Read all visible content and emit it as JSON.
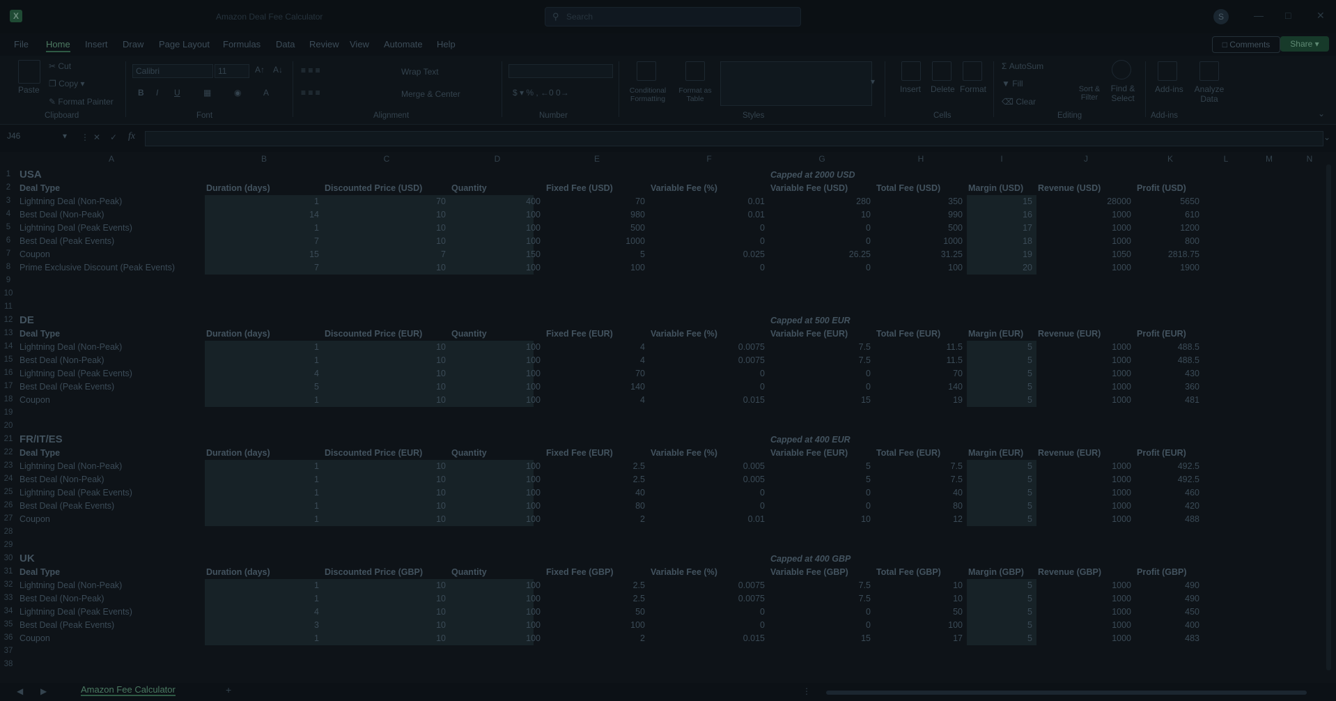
{
  "titlebar": {
    "app_icon": "excel-icon",
    "title": "Amazon Deal Fee Calculator",
    "search_placeholder": "Search",
    "avatar_letter": "S"
  },
  "menu": {
    "items": [
      "File",
      "Home",
      "Insert",
      "Draw",
      "Page Layout",
      "Formulas",
      "Data",
      "Review",
      "View",
      "Automate",
      "Help"
    ],
    "active": "Home",
    "comments_label": "Comments",
    "share_label": "Share"
  },
  "ribbon": {
    "clipboard": {
      "paste": "Paste",
      "cut": "Cut",
      "copy": "Copy",
      "format_painter": "Format Painter",
      "group": "Clipboard"
    },
    "font": {
      "name": "Calibri",
      "size": "11",
      "group": "Font"
    },
    "alignment": {
      "wrap": "Wrap Text",
      "merge": "Merge & Center",
      "group": "Alignment"
    },
    "number": {
      "group": "Number"
    },
    "styles": {
      "conditional": "Conditional Formatting",
      "format_table": "Format as Table",
      "group": "Styles"
    },
    "cells": {
      "insert": "Insert",
      "delete": "Delete",
      "format": "Format",
      "group": "Cells"
    },
    "editing": {
      "autosum": "AutoSum",
      "fill": "Fill",
      "clear": "Clear",
      "sort": "Sort & Filter",
      "find": "Find & Select",
      "group": "Editing"
    },
    "addins": {
      "addins": "Add-ins",
      "analyze": "Analyze Data",
      "group": "Add-ins"
    }
  },
  "formula_bar": {
    "name_box": "J46",
    "fx": "fx"
  },
  "columns": [
    "A",
    "B",
    "C",
    "D",
    "E",
    "F",
    "G",
    "H",
    "I",
    "J",
    "K",
    "L",
    "M",
    "N"
  ],
  "rows": [
    "1",
    "2",
    "3",
    "4",
    "5",
    "6",
    "7",
    "8",
    "9",
    "10",
    "11",
    "12",
    "13",
    "14",
    "15",
    "16",
    "17",
    "18",
    "19",
    "20",
    "21",
    "22",
    "23",
    "24",
    "25",
    "26",
    "27",
    "28",
    "29",
    "30",
    "31",
    "32",
    "33",
    "34",
    "35",
    "36",
    "37",
    "38"
  ],
  "tables": [
    {
      "region": "USA",
      "cap": "Capped at 2000 USD",
      "headers": [
        "Deal Type",
        "Duration (days)",
        "Discounted Price (USD)",
        "Quantity",
        "Fixed Fee (USD)",
        "Variable Fee (%)",
        "Variable Fee (USD)",
        "Total Fee (USD)",
        "Margin (USD)",
        "Revenue (USD)",
        "Profit (USD)"
      ],
      "rows": [
        [
          "Lightning Deal (Non-Peak)",
          "1",
          "70",
          "400",
          "70",
          "0.01",
          "280",
          "350",
          "15",
          "28000",
          "5650"
        ],
        [
          "Best Deal (Non-Peak)",
          "14",
          "10",
          "100",
          "980",
          "0.01",
          "10",
          "990",
          "16",
          "1000",
          "610"
        ],
        [
          "Lightning Deal (Peak Events)",
          "1",
          "10",
          "100",
          "500",
          "0",
          "0",
          "500",
          "17",
          "1000",
          "1200"
        ],
        [
          "Best Deal (Peak Events)",
          "7",
          "10",
          "100",
          "1000",
          "0",
          "0",
          "1000",
          "18",
          "1000",
          "800"
        ],
        [
          "Coupon",
          "15",
          "7",
          "150",
          "5",
          "0.025",
          "26.25",
          "31.25",
          "19",
          "1050",
          "2818.75"
        ],
        [
          "Prime Exclusive Discount (Peak Events)",
          "7",
          "10",
          "100",
          "100",
          "0",
          "0",
          "100",
          "20",
          "1000",
          "1900"
        ]
      ]
    },
    {
      "region": "DE",
      "cap": "Capped at 500 EUR",
      "headers": [
        "Deal Type",
        "Duration (days)",
        "Discounted Price (EUR)",
        "Quantity",
        "Fixed Fee (EUR)",
        "Variable Fee (%)",
        "Variable Fee (EUR)",
        "Total Fee (EUR)",
        "Margin (EUR)",
        "Revenue (EUR)",
        "Profit (EUR)"
      ],
      "rows": [
        [
          "Lightning Deal (Non-Peak)",
          "1",
          "10",
          "100",
          "4",
          "0.0075",
          "7.5",
          "11.5",
          "5",
          "1000",
          "488.5"
        ],
        [
          "Best Deal (Non-Peak)",
          "1",
          "10",
          "100",
          "4",
          "0.0075",
          "7.5",
          "11.5",
          "5",
          "1000",
          "488.5"
        ],
        [
          "Lightning Deal (Peak Events)",
          "4",
          "10",
          "100",
          "70",
          "0",
          "0",
          "70",
          "5",
          "1000",
          "430"
        ],
        [
          "Best Deal (Peak Events)",
          "5",
          "10",
          "100",
          "140",
          "0",
          "0",
          "140",
          "5",
          "1000",
          "360"
        ],
        [
          "Coupon",
          "1",
          "10",
          "100",
          "4",
          "0.015",
          "15",
          "19",
          "5",
          "1000",
          "481"
        ]
      ]
    },
    {
      "region": "FR/IT/ES",
      "cap": "Capped at 400 EUR",
      "headers": [
        "Deal Type",
        "Duration (days)",
        "Discounted Price (EUR)",
        "Quantity",
        "Fixed Fee (EUR)",
        "Variable Fee (%)",
        "Variable Fee (EUR)",
        "Total Fee (EUR)",
        "Margin (EUR)",
        "Revenue (EUR)",
        "Profit (EUR)"
      ],
      "rows": [
        [
          "Lightning Deal (Non-Peak)",
          "1",
          "10",
          "100",
          "2.5",
          "0.005",
          "5",
          "7.5",
          "5",
          "1000",
          "492.5"
        ],
        [
          "Best Deal (Non-Peak)",
          "1",
          "10",
          "100",
          "2.5",
          "0.005",
          "5",
          "7.5",
          "5",
          "1000",
          "492.5"
        ],
        [
          "Lightning Deal (Peak Events)",
          "1",
          "10",
          "100",
          "40",
          "0",
          "0",
          "40",
          "5",
          "1000",
          "460"
        ],
        [
          "Best Deal (Peak Events)",
          "1",
          "10",
          "100",
          "80",
          "0",
          "0",
          "80",
          "5",
          "1000",
          "420"
        ],
        [
          "Coupon",
          "1",
          "10",
          "100",
          "2",
          "0.01",
          "10",
          "12",
          "5",
          "1000",
          "488"
        ]
      ]
    },
    {
      "region": "UK",
      "cap": "Capped at 400 GBP",
      "headers": [
        "Deal Type",
        "Duration (days)",
        "Discounted Price (GBP)",
        "Quantity",
        "Fixed Fee (GBP)",
        "Variable Fee (%)",
        "Variable Fee (GBP)",
        "Total Fee (GBP)",
        "Margin (GBP)",
        "Revenue (GBP)",
        "Profit (GBP)"
      ],
      "rows": [
        [
          "Lightning Deal (Non-Peak)",
          "1",
          "10",
          "100",
          "2.5",
          "0.0075",
          "7.5",
          "10",
          "5",
          "1000",
          "490"
        ],
        [
          "Best Deal (Non-Peak)",
          "1",
          "10",
          "100",
          "2.5",
          "0.0075",
          "7.5",
          "10",
          "5",
          "1000",
          "490"
        ],
        [
          "Lightning Deal (Peak Events)",
          "4",
          "10",
          "100",
          "50",
          "0",
          "0",
          "50",
          "5",
          "1000",
          "450"
        ],
        [
          "Best Deal (Peak Events)",
          "3",
          "10",
          "100",
          "100",
          "0",
          "0",
          "100",
          "5",
          "1000",
          "400"
        ],
        [
          "Coupon",
          "1",
          "10",
          "100",
          "2",
          "0.015",
          "15",
          "17",
          "5",
          "1000",
          "483"
        ]
      ]
    }
  ],
  "sheet_tab": "Amazon Fee Calculator",
  "add_sheet": "+"
}
